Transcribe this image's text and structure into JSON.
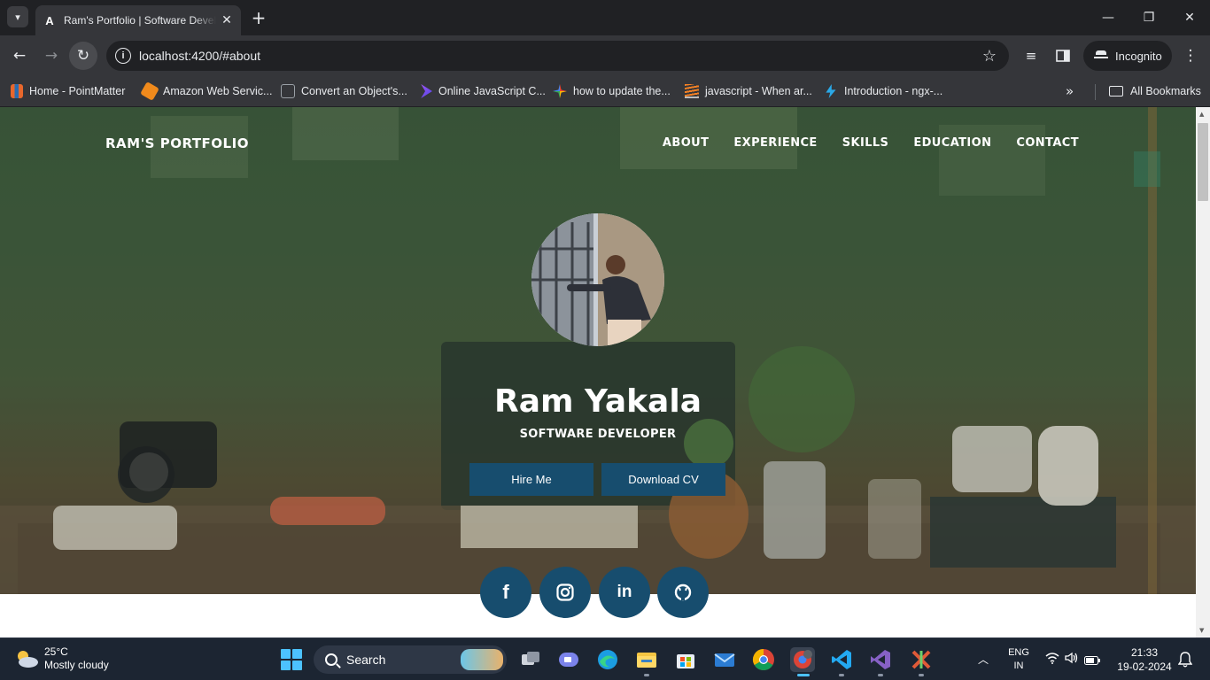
{
  "browser": {
    "tab_title": "Ram's Portfolio | Software Developer",
    "tab_favicon": "A",
    "url": "localhost:4200/#about",
    "incognito_label": "Incognito"
  },
  "bookmarks": [
    {
      "label": "Home - PointMatter",
      "color": "#e8672c"
    },
    {
      "label": "Amazon Web Servic...",
      "color": "#f08a1c"
    },
    {
      "label": "Convert an Object's...",
      "color": "#9aa0a6"
    },
    {
      "label": "Online JavaScript C...",
      "color": "#7c3aed"
    },
    {
      "label": "how to update the...",
      "color": "#6aa84f"
    },
    {
      "label": "javascript - When ar...",
      "color": "#f48024"
    },
    {
      "label": "Introduction - ngx-...",
      "color": "#2aa8e6"
    }
  ],
  "all_bookmarks_label": "All Bookmarks",
  "site": {
    "brand": "RAM'S PORTFOLIO",
    "nav": [
      "ABOUT",
      "EXPERIENCE",
      "SKILLS",
      "EDUCATION",
      "CONTACT"
    ],
    "name": "Ram Yakala",
    "role": "SOFTWARE DEVELOPER",
    "hire_label": "Hire Me",
    "cv_label": "Download CV",
    "accent_color": "#174d6e",
    "social": [
      {
        "name": "facebook-icon",
        "glyph": "f"
      },
      {
        "name": "instagram-icon",
        "glyph": ""
      },
      {
        "name": "linkedin-icon",
        "glyph": "in"
      },
      {
        "name": "github-icon",
        "glyph": ""
      }
    ]
  },
  "taskbar": {
    "temperature": "25°C",
    "weather": "Mostly cloudy",
    "search_label": "Search",
    "lang_1": "ENG",
    "lang_2": "IN",
    "time": "21:33",
    "date": "19-02-2024"
  }
}
